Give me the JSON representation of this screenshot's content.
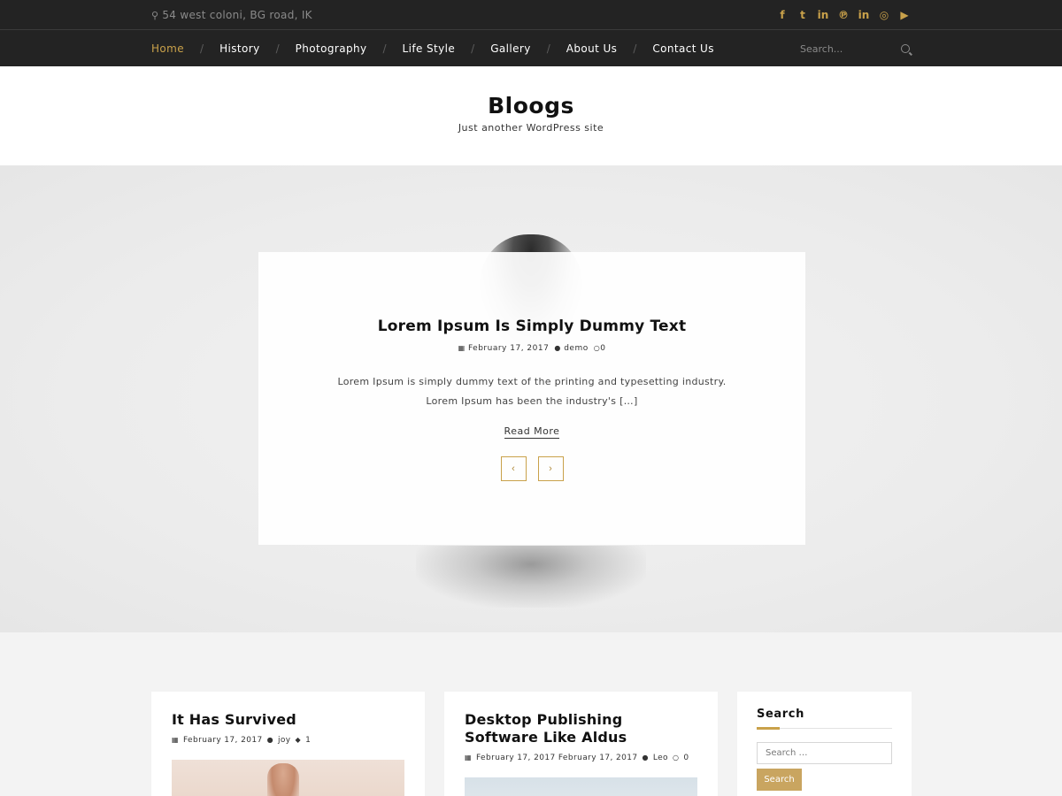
{
  "topbar": {
    "address_icon": "map-marker-icon",
    "address": "54 west coloni, BG road, IK",
    "social": [
      {
        "name": "facebook-icon",
        "glyph": "f"
      },
      {
        "name": "twitter-icon",
        "glyph": "t"
      },
      {
        "name": "linkedin-icon",
        "glyph": "in"
      },
      {
        "name": "pinterest-icon",
        "glyph": "℗"
      },
      {
        "name": "linkedin-icon-2",
        "glyph": "in"
      },
      {
        "name": "dribbble-icon",
        "glyph": "◎"
      },
      {
        "name": "youtube-icon",
        "glyph": "▶"
      }
    ],
    "accent_color": "#c9a14a"
  },
  "nav": {
    "items": [
      "Home",
      "History",
      "Photography",
      "Life Style",
      "Gallery",
      "About Us",
      "Contact Us"
    ],
    "separator": "/",
    "search_placeholder": "Search..."
  },
  "header": {
    "title": "Bloogs",
    "tagline": "Just another WordPress site"
  },
  "slider": {
    "title": "Lorem Ipsum Is Simply Dummy Text",
    "date": "February 17, 2017",
    "author": "demo",
    "comments": "0",
    "excerpt": "Lorem Ipsum is simply dummy text of the printing and typesetting industry. Lorem Ipsum has been the industry's […]",
    "read_more": "Read More",
    "prev": "‹",
    "next": "›"
  },
  "posts": [
    {
      "title": "It Has Survived",
      "date": "February 17, 2017",
      "author": "joy",
      "comments": "1"
    },
    {
      "title": "Desktop Publishing Software Like Aldus",
      "date": "February 17, 2017 February 17, 2017",
      "author": "Leo",
      "comments": "0"
    }
  ],
  "sidebar": {
    "search_title": "Search",
    "search_placeholder": "Search …",
    "search_button": "Search"
  }
}
